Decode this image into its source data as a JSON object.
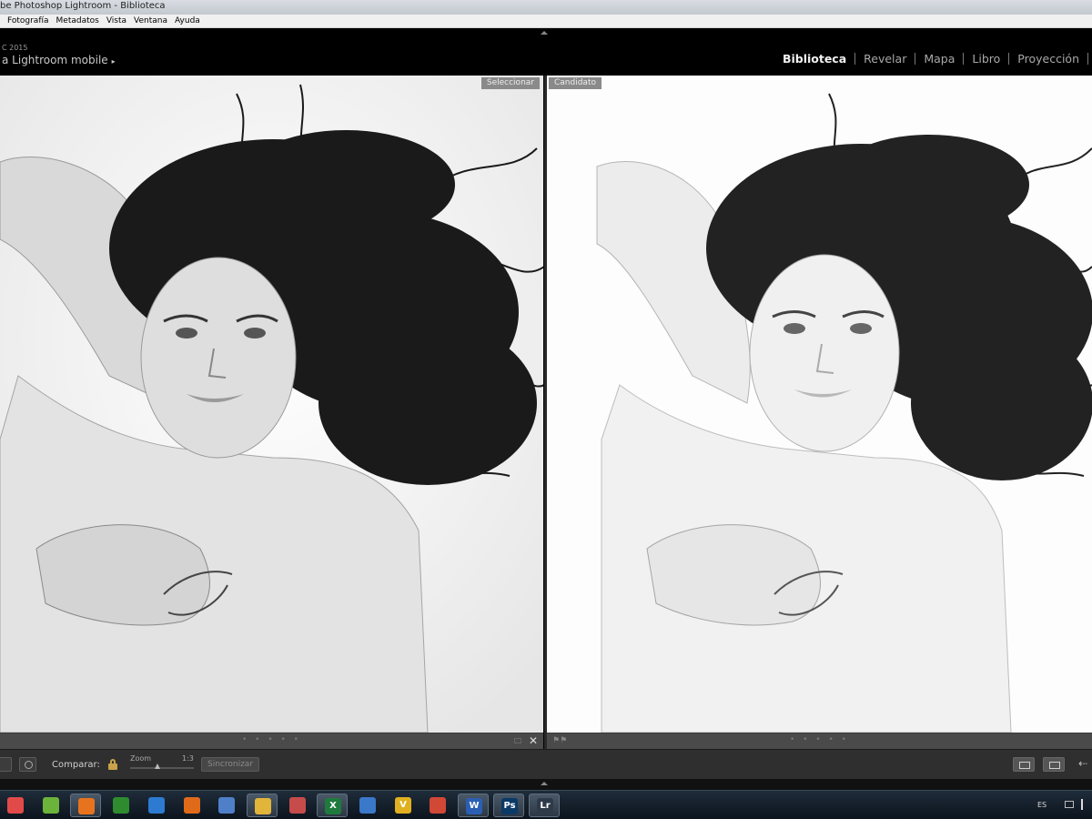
{
  "window": {
    "title": "be Photoshop Lightroom - Biblioteca"
  },
  "menu": [
    "Fotografía",
    "Metadatos",
    "Vista",
    "Ventana",
    "Ayuda"
  ],
  "identity": {
    "version": "C 2015",
    "mobile_link": "a Lightroom mobile",
    "play_glyph": "▸"
  },
  "modules": [
    {
      "label": "Biblioteca",
      "active": true
    },
    {
      "label": "Revelar",
      "active": false
    },
    {
      "label": "Mapa",
      "active": false
    },
    {
      "label": "Libro",
      "active": false
    },
    {
      "label": "Proyección",
      "active": false
    }
  ],
  "compare": {
    "select_label": "Seleccionar",
    "candidate_label": "Candidato",
    "close_glyph": "✕",
    "flags_glyph": "⚑⚑",
    "dots": "• • • • •"
  },
  "toolbar": {
    "compare_label": "Comparar:",
    "zoom_label": "Zoom",
    "zoom_ratio": "1:3",
    "sync_label": "Sincronizar",
    "arrow_glyph": "⇠"
  },
  "taskbar": {
    "apps": [
      {
        "name": "picasa-icon",
        "glyph": "",
        "color": "#e24a4a"
      },
      {
        "name": "game-icon",
        "glyph": "",
        "color": "#6bb33a"
      },
      {
        "name": "firefox-icon",
        "glyph": "",
        "color": "#e8731f",
        "open": true
      },
      {
        "name": "nvidia-icon",
        "glyph": "",
        "color": "#2e8c2e"
      },
      {
        "name": "dropbox-icon",
        "glyph": "",
        "color": "#2d7bd1"
      },
      {
        "name": "burner-icon",
        "glyph": "",
        "color": "#e06a1a"
      },
      {
        "name": "photo-viewer-icon",
        "glyph": "",
        "color": "#4f7fc9"
      },
      {
        "name": "outlook-icon",
        "glyph": "",
        "color": "#e0b53a",
        "open": true
      },
      {
        "name": "globe-icon",
        "glyph": "",
        "color": "#c64c4c"
      },
      {
        "name": "excel-icon",
        "glyph": "X",
        "color": "#1f7a3e",
        "open": true
      },
      {
        "name": "chart-icon",
        "glyph": "",
        "color": "#3a78c9"
      },
      {
        "name": "vectorworks-icon",
        "glyph": "V",
        "color": "#e0b020"
      },
      {
        "name": "chrome-icon",
        "glyph": "",
        "color": "#d14836"
      },
      {
        "name": "word-icon",
        "glyph": "W",
        "color": "#2b5fb4",
        "open": true
      },
      {
        "name": "photoshop-icon",
        "glyph": "Ps",
        "color": "#0b3a66",
        "open": true
      },
      {
        "name": "lightroom-icon",
        "glyph": "Lr",
        "color": "#2e3a4a",
        "open": true
      }
    ],
    "language": "ES"
  }
}
